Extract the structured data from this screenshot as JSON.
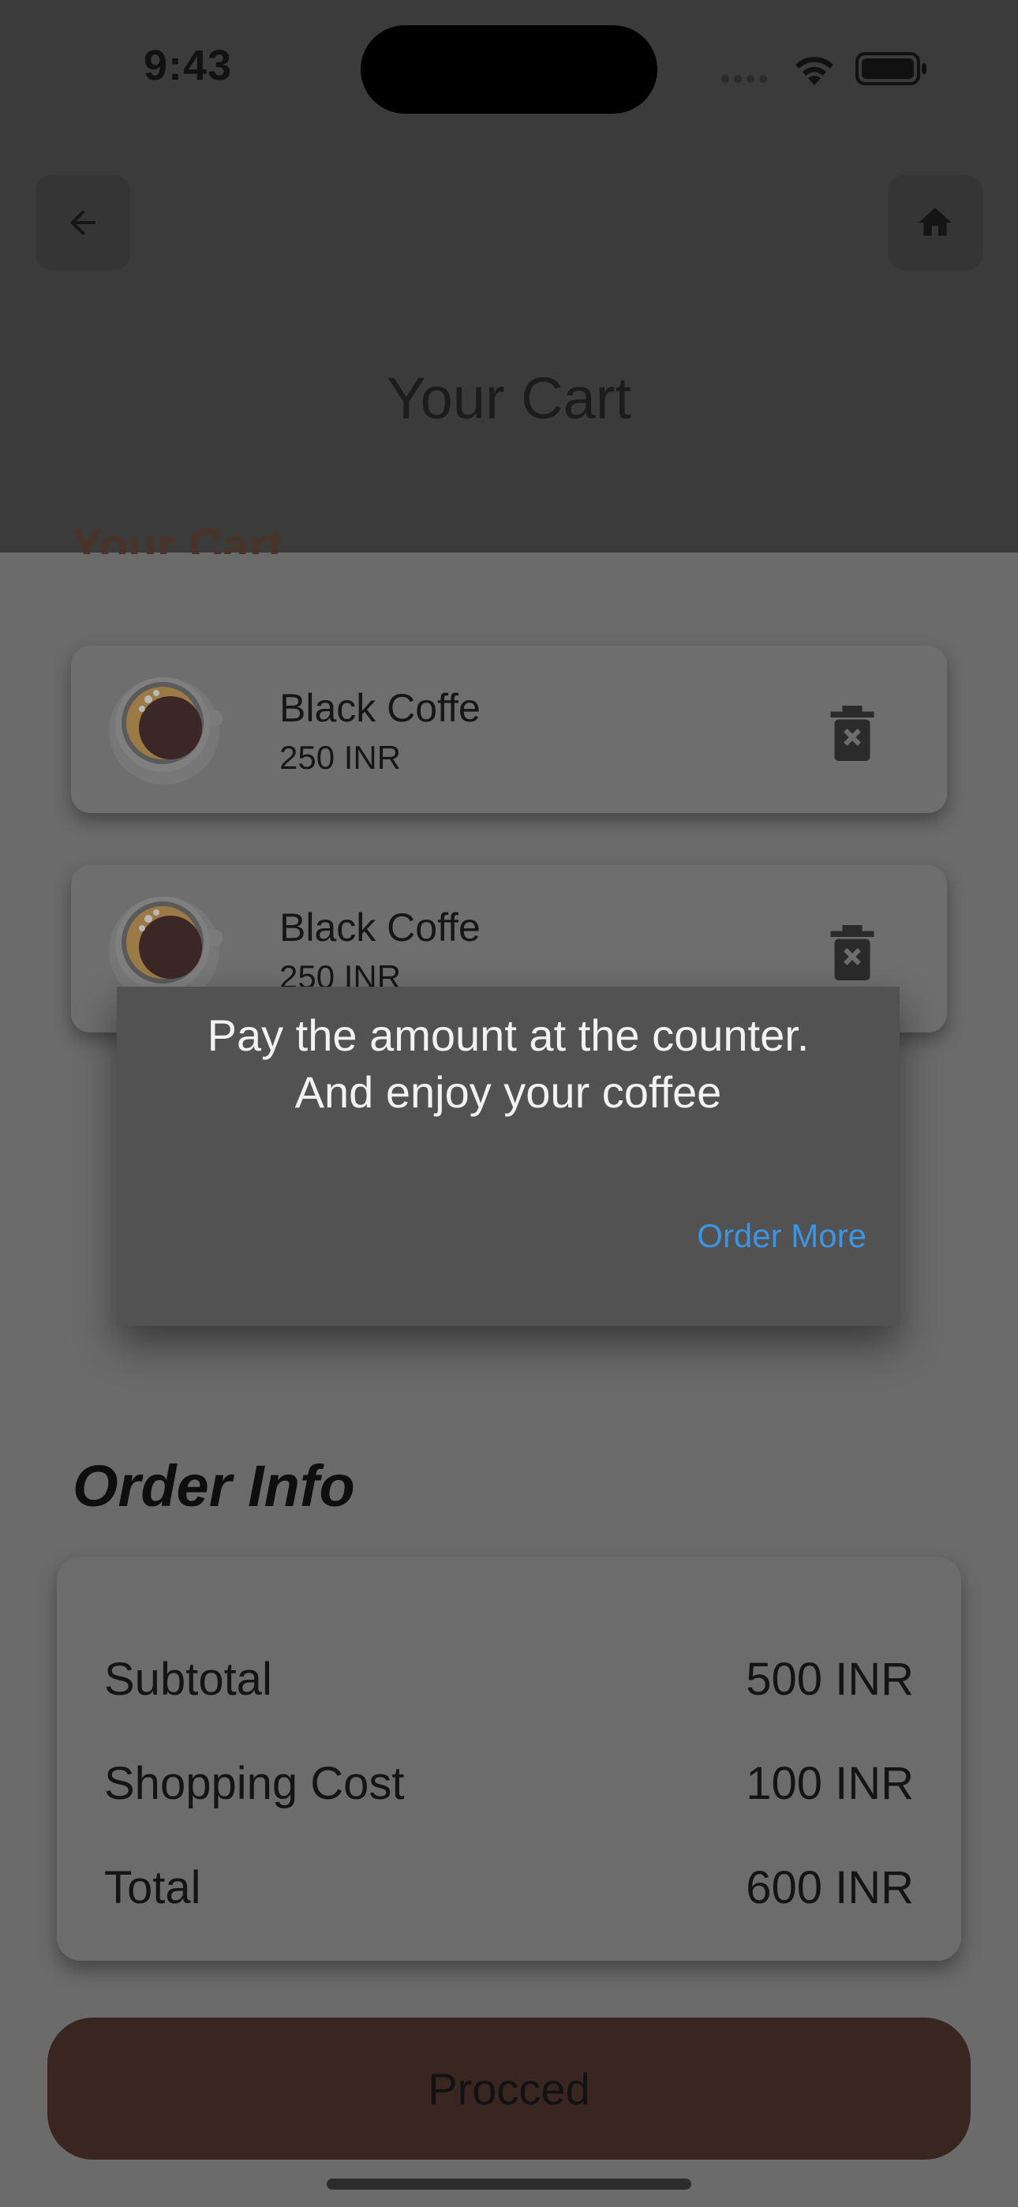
{
  "status_bar": {
    "time": "9:43"
  },
  "app_bar": {
    "title": "Your Cart"
  },
  "cart": {
    "heading": "Your Cart",
    "items": [
      {
        "name": "Black Coffe",
        "price": "250 INR"
      },
      {
        "name": "Black Coffe",
        "price": "250 INR"
      }
    ]
  },
  "dialog": {
    "message_line1": "Pay the amount at the counter.",
    "message_line2": "And enjoy your coffee",
    "action_label": "Order More"
  },
  "order_info": {
    "title": "Order Info",
    "rows": [
      {
        "label": "Subtotal",
        "value": "500 INR"
      },
      {
        "label": "Shopping Cost",
        "value": "100 INR"
      },
      {
        "label": "Total",
        "value": "600 INR"
      }
    ]
  },
  "proceed_label": "Procced",
  "colors": {
    "scrim": "#6b6b6b",
    "app_bar": "#3b3b3b",
    "accent_link": "#3d94e0",
    "proceed_button": "#3a2621"
  }
}
